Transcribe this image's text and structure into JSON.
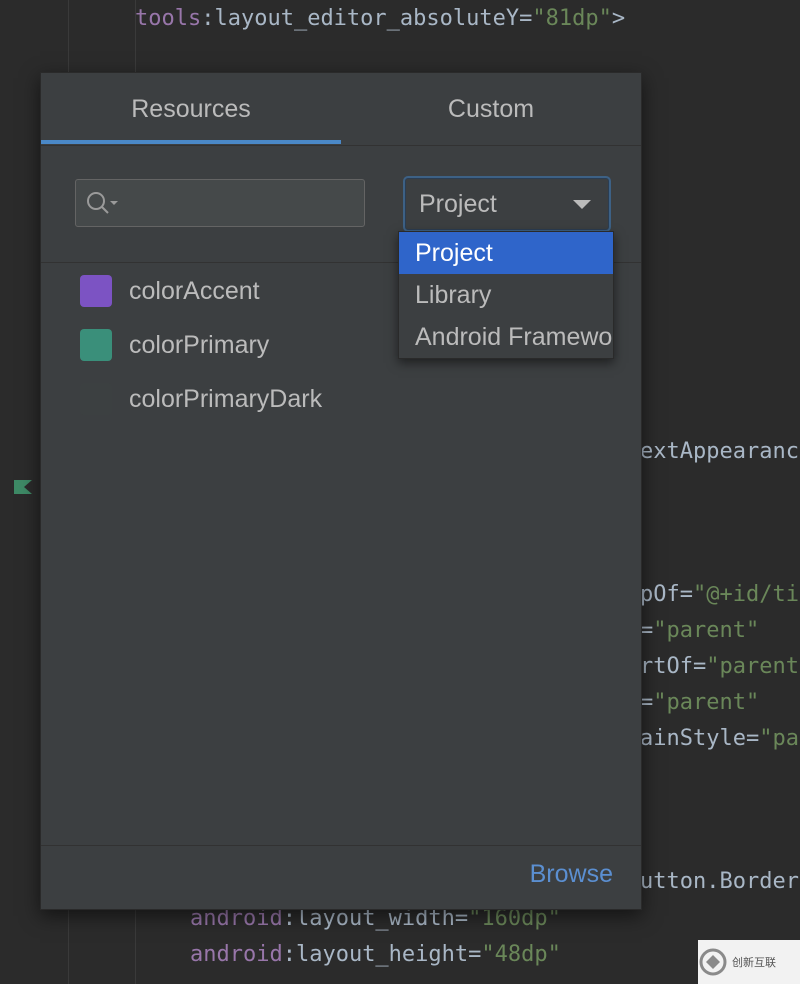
{
  "editor": {
    "lines": [
      {
        "parts": [
          {
            "t": "tools",
            "c": "ns"
          },
          {
            "t": ":layout_editor_absoluteY=",
            "c": ""
          },
          {
            "t": "\"81dp\"",
            "c": "str"
          },
          {
            "t": ">",
            "c": ""
          }
        ]
      },
      {
        "parts": [
          {
            "t": "extAppearanc",
            "c": ""
          }
        ]
      },
      {
        "parts": [
          {
            "t": "pOf=",
            "c": ""
          },
          {
            "t": "\"@+id/ti",
            "c": "str"
          }
        ]
      },
      {
        "parts": [
          {
            "t": "=",
            "c": ""
          },
          {
            "t": "\"parent\"",
            "c": "str"
          }
        ]
      },
      {
        "parts": [
          {
            "t": "rtOf=",
            "c": ""
          },
          {
            "t": "\"parent",
            "c": "str"
          }
        ]
      },
      {
        "parts": [
          {
            "t": "=",
            "c": ""
          },
          {
            "t": "\"parent\"",
            "c": "str"
          }
        ]
      },
      {
        "parts": [
          {
            "t": "ainStyle=",
            "c": ""
          },
          {
            "t": "\"pa",
            "c": "str"
          }
        ]
      },
      {
        "parts": [
          {
            "t": "utton.Border",
            "c": ""
          }
        ]
      },
      {
        "parts": [
          {
            "t": "android",
            "c": "ns"
          },
          {
            "t": ":layout_width=",
            "c": ""
          },
          {
            "t": "\"160dp\"",
            "c": "str"
          }
        ]
      },
      {
        "parts": [
          {
            "t": "android",
            "c": "ns"
          },
          {
            "t": ":layout_height=",
            "c": ""
          },
          {
            "t": "\"48dp\"",
            "c": "str"
          }
        ]
      }
    ]
  },
  "popup": {
    "tabs": [
      {
        "label": "Resources",
        "active": true
      },
      {
        "label": "Custom",
        "active": false
      }
    ],
    "search": {
      "value": "",
      "placeholder": ""
    },
    "source_select": {
      "value": "Project"
    },
    "resources": [
      {
        "name": "colorAccent",
        "color": "#7c53c3"
      },
      {
        "name": "colorPrimary",
        "color": "#3a8f7a"
      },
      {
        "name": "colorPrimaryDark",
        "color": "#3c4041"
      }
    ],
    "browse_label": "Browse"
  },
  "dropdown": {
    "options": [
      {
        "label": "Project",
        "selected": true
      },
      {
        "label": "Library",
        "selected": false
      },
      {
        "label": "Android Framework",
        "selected": false
      }
    ]
  },
  "watermark": {
    "text": "创新互联"
  },
  "colors": {
    "accent": "#4a88c7",
    "selection": "#2f65ca",
    "link": "#5b8fd1"
  }
}
